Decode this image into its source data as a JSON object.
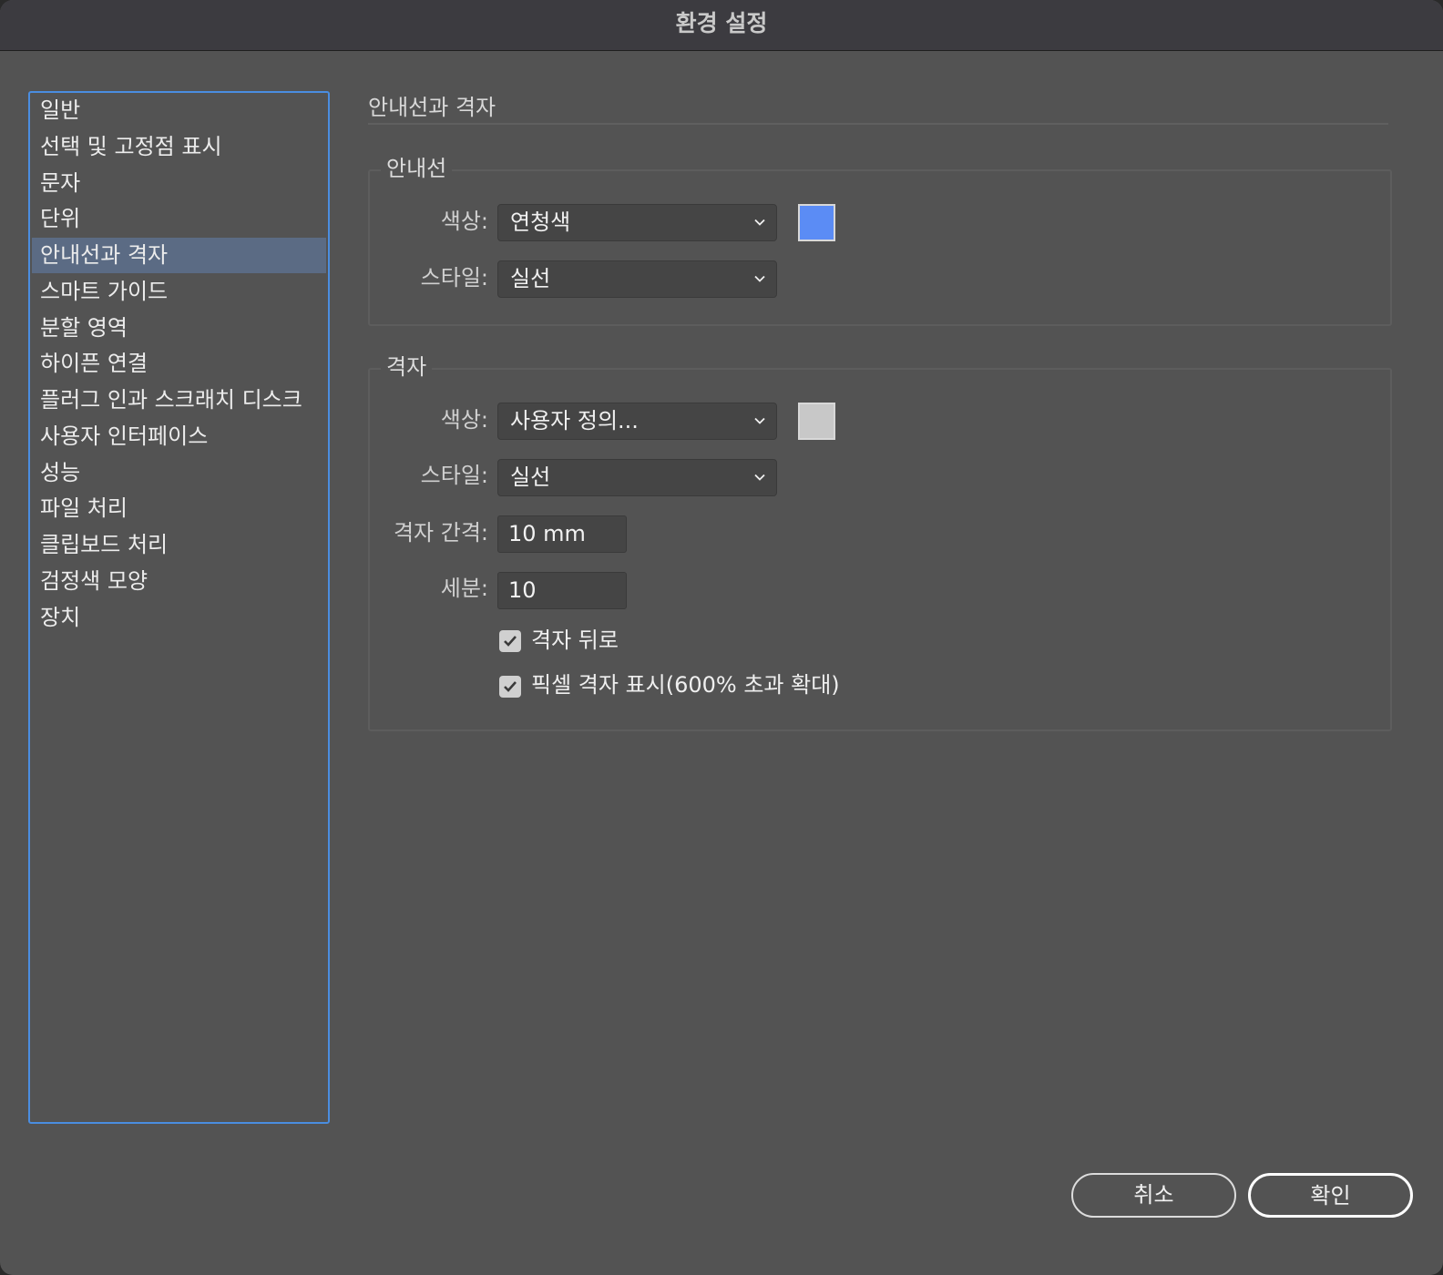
{
  "window": {
    "title": "환경 설정"
  },
  "sidebar": {
    "items": [
      {
        "label": "일반"
      },
      {
        "label": "선택 및 고정점 표시"
      },
      {
        "label": "문자"
      },
      {
        "label": "단위"
      },
      {
        "label": "안내선과 격자",
        "selected": true
      },
      {
        "label": "스마트 가이드"
      },
      {
        "label": "분할 영역"
      },
      {
        "label": "하이픈 연결"
      },
      {
        "label": "플러그 인과 스크래치 디스크"
      },
      {
        "label": "사용자 인터페이스"
      },
      {
        "label": "성능"
      },
      {
        "label": "파일 처리"
      },
      {
        "label": "클립보드 처리"
      },
      {
        "label": "검정색 모양"
      },
      {
        "label": "장치"
      }
    ]
  },
  "page": {
    "title": "안내선과 격자"
  },
  "guides": {
    "group_title": "안내선",
    "color_label": "색상:",
    "color_value": "연청색",
    "swatch_color": "#5b8cf5",
    "style_label": "스타일:",
    "style_value": "실선"
  },
  "grid": {
    "group_title": "격자",
    "color_label": "색상:",
    "color_value": "사용자 정의...",
    "swatch_color": "#c8c8c8",
    "style_label": "스타일:",
    "style_value": "실선",
    "spacing_label": "격자 간격:",
    "spacing_value": "10 mm",
    "subdivision_label": "세분:",
    "subdivision_value": "10",
    "grids_in_back": {
      "label": "격자 뒤로",
      "checked": true
    },
    "pixel_grid": {
      "label": "픽셀 격자 표시(600% 초과 확대)",
      "checked": true
    }
  },
  "buttons": {
    "cancel": "취소",
    "ok": "확인"
  },
  "colors": {
    "accent": "#4a8de0",
    "selected_row": "#5b6b84",
    "panel": "#535353"
  }
}
